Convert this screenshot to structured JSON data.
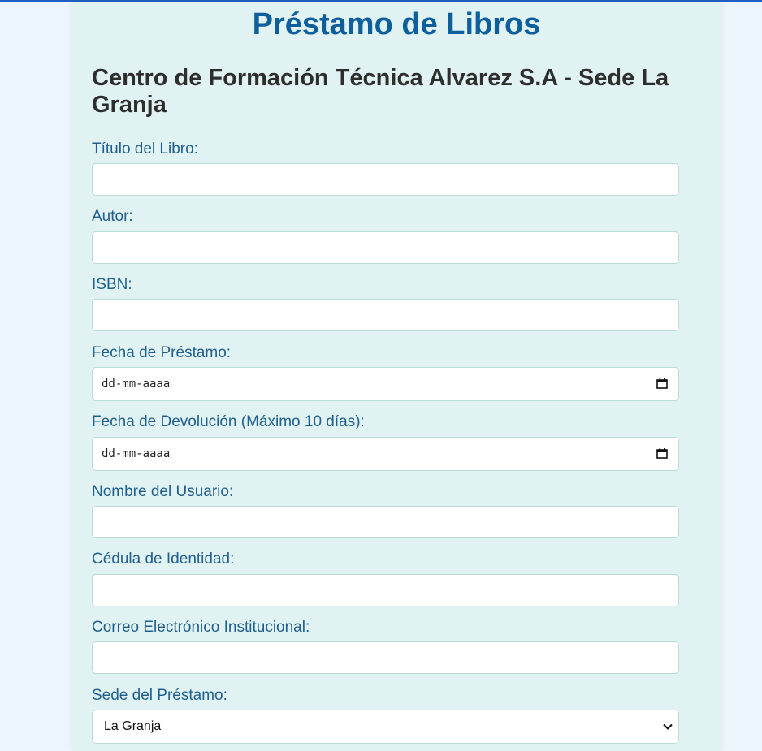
{
  "page": {
    "title": "Préstamo de Libros",
    "subtitle": "Centro de Formación Técnica Alvarez S.A - Sede La Granja"
  },
  "form": {
    "titulo": {
      "label": "Título del Libro:",
      "value": ""
    },
    "autor": {
      "label": "Autor:",
      "value": ""
    },
    "isbn": {
      "label": "ISBN:",
      "value": ""
    },
    "fecha_prestamo": {
      "label": "Fecha de Préstamo:",
      "placeholder": "dd-mm-aaaa"
    },
    "fecha_devolucion": {
      "label": "Fecha de Devolución (Máximo 10 días):",
      "placeholder": "dd-mm-aaaa"
    },
    "nombre": {
      "label": "Nombre del Usuario:",
      "value": ""
    },
    "cedula": {
      "label": "Cédula de Identidad:",
      "value": ""
    },
    "correo": {
      "label": "Correo Electrónico Institucional:",
      "value": ""
    },
    "sede": {
      "label": "Sede del Préstamo:",
      "selected": "La Granja"
    }
  },
  "icons": {
    "date": "calendar-icon",
    "select": "chevron-down-icon"
  },
  "colors": {
    "title": "#0d5e9c",
    "label": "#1f5f8f",
    "card_background": "#e0f2f1",
    "page_background": "#eef6fd",
    "top_bar": "#1f5fbf"
  }
}
